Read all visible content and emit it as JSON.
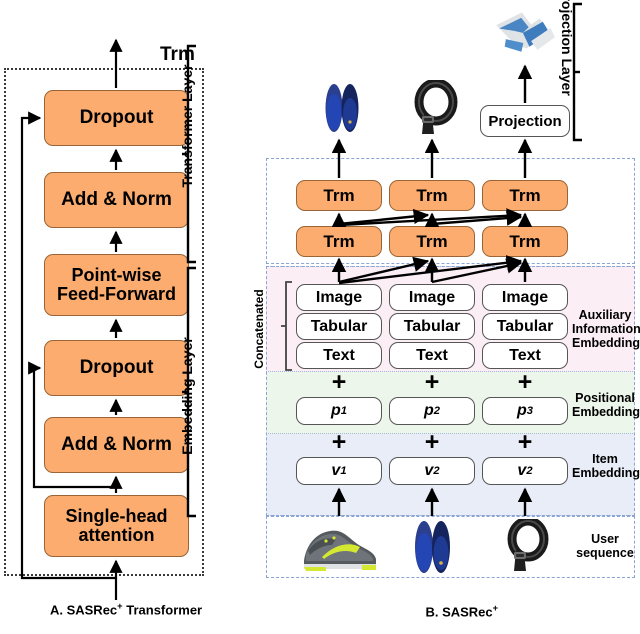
{
  "figure": {
    "panel_a": {
      "caption_main": "A. SASRec",
      "caption_sup": "+",
      "caption_tail": " Transformer",
      "trm_label": "Trm",
      "blocks": [
        {
          "label": "Dropout"
        },
        {
          "label": "Add & Norm"
        },
        {
          "label": "Point-wise\nFeed-Forward"
        },
        {
          "label": "Dropout"
        },
        {
          "label": "Add & Norm"
        },
        {
          "label": "Single-head\nattention"
        }
      ]
    },
    "panel_b": {
      "caption_main": "B. SASRec",
      "caption_sup": "+",
      "side_labels": {
        "projection_layer": "Projection Layer",
        "transformer_layer": "Transformer Layer",
        "embedding_layer": "Embedding Layer",
        "concatenated": "Concatenated"
      },
      "right_labels": {
        "auxiliary": "Auxiliary\nInformation\nEmbedding",
        "positional": "Positional\nEmbedding",
        "item": "Item\nEmbedding",
        "user_sequence": "User\nsequence"
      },
      "projection": {
        "label": "Projection"
      },
      "transformer": {
        "row_top": [
          "Trm",
          "Trm",
          "Trm"
        ],
        "row_bottom": [
          "Trm",
          "Trm",
          "Trm"
        ]
      },
      "auxiliary_rows": [
        [
          "Image",
          "Image",
          "Image"
        ],
        [
          "Tabular",
          "Tabular",
          "Tabular"
        ],
        [
          "Text",
          "Text",
          "Text"
        ]
      ],
      "positional_embeddings": [
        {
          "symbol": "p",
          "index": "1"
        },
        {
          "symbol": "p",
          "index": "2"
        },
        {
          "symbol": "p",
          "index": "3"
        }
      ],
      "item_embeddings": [
        {
          "symbol": "v",
          "index": "1"
        },
        {
          "symbol": "v",
          "index": "2"
        },
        {
          "symbol": "v",
          "index": "2"
        }
      ],
      "plus_sign": "+",
      "output_items": [
        {
          "name": "blue-insoles-product-image"
        },
        {
          "name": "black-belt-product-image"
        },
        {
          "name": "blue-white-apparel-product-image"
        }
      ],
      "sequence_items": [
        {
          "name": "gray-yellow-running-shoe-product-image"
        },
        {
          "name": "blue-insoles-product-image"
        },
        {
          "name": "black-belt-product-image"
        }
      ]
    },
    "colors": {
      "block_orange": "#FBAC6E",
      "band_auxiliary": "#FBEEF4",
      "band_positional": "#EDF6EA",
      "band_item": "#E9EDF8",
      "frame_blue": "#8AA4D4",
      "stroke_black": "#000000"
    }
  }
}
